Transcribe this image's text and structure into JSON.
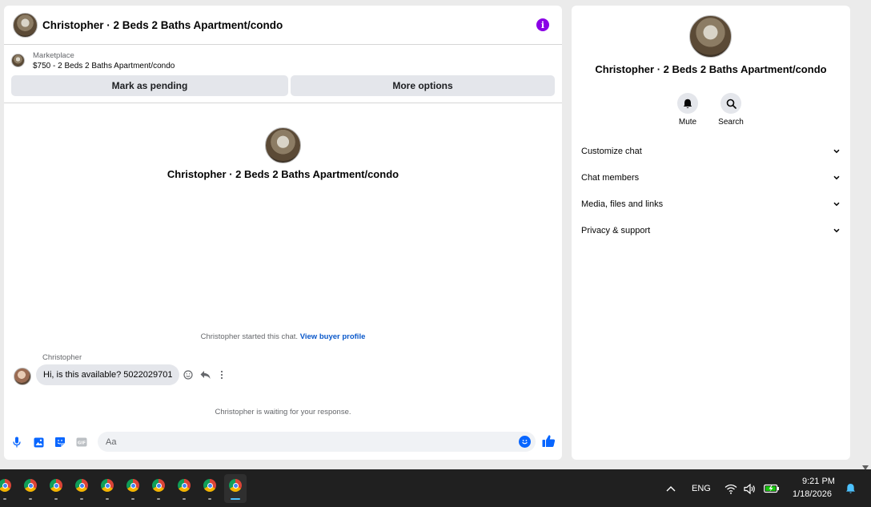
{
  "chat": {
    "header_title": "Christopher · 2 Beds 2 Baths Apartment/condo",
    "info_icon_glyph": "i",
    "listing": {
      "source": "Marketplace",
      "price_line": "$750 - 2 Beds 2 Baths Apartment/condo",
      "pending_label": "Mark as pending",
      "more_label": "More options"
    },
    "center_title": "Christopher · 2 Beds 2 Baths Apartment/condo",
    "started_text": "Christopher started this chat.",
    "buyer_profile_link": "View buyer profile",
    "sender_name": "Christopher",
    "message_text": "Hi, is this available? 5022029701",
    "waiting_text": "Christopher is waiting for your response.",
    "composer_placeholder": "Aa",
    "composer_value": "",
    "icons": [
      "microphone-icon",
      "photo-icon",
      "sticker-icon",
      "gif-icon",
      "emoji-icon",
      "like-icon"
    ],
    "accent_color": "#0866ff"
  },
  "info_panel": {
    "title": "Christopher · 2 Beds 2 Baths Apartment/condo",
    "mute_label": "Mute",
    "search_label": "Search",
    "rows": [
      {
        "label": "Customize chat"
      },
      {
        "label": "Chat members"
      },
      {
        "label": "Media, files and links"
      },
      {
        "label": "Privacy & support"
      }
    ]
  },
  "taskbar": {
    "language": "ENG",
    "time": "9:21 PM",
    "date": "1/18/2026",
    "app_icon": "chrome-icon",
    "app_count": 10
  }
}
